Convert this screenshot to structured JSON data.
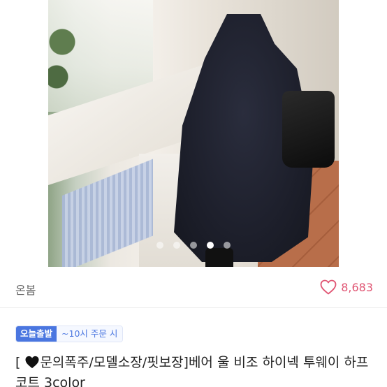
{
  "image": {
    "carousel_total": 5,
    "carousel_active_index": 3
  },
  "seller": {
    "name": "온봄"
  },
  "likes": {
    "count": "8,683",
    "color": "#e05573"
  },
  "shipping_badge": {
    "label": "오늘출발",
    "condition": "~10시 주문 시",
    "color": "#4a76e0"
  },
  "product": {
    "title_prefix": "[ ",
    "title_icon": "black-heart-icon",
    "title_text": "문의폭주/모델소장/핏보장]베어 울 비조 하이넥 투웨이 하프코트 3color"
  }
}
